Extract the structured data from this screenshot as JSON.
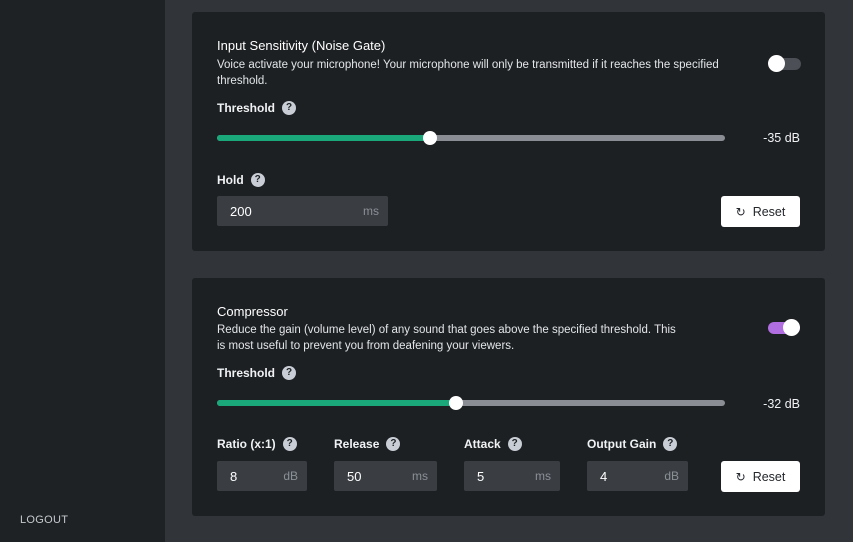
{
  "sidebar": {
    "logout_label": "LOGOUT"
  },
  "noise_gate": {
    "title": "Input Sensitivity (Noise Gate)",
    "description_line1": "Voice activate your microphone! Your microphone will only be transmitted if it reaches the specified",
    "description_line2": "threshold.",
    "enabled": false,
    "threshold_label": "Threshold",
    "threshold_value_text": "-35 dB",
    "threshold_fraction": 0.42,
    "hold_label": "Hold",
    "hold_value": "200",
    "hold_unit": "ms",
    "reset_label": "Reset"
  },
  "compressor": {
    "title": "Compressor",
    "description_line1": "Reduce the gain (volume level) of any sound that goes above the specified threshold. This",
    "description_line2": "is most useful to prevent you from deafening your viewers.",
    "enabled": true,
    "threshold_label": "Threshold",
    "threshold_value_text": "-32 dB",
    "threshold_fraction": 0.47,
    "ratio_label": "Ratio (x:1)",
    "ratio_value": "8",
    "ratio_unit": "dB",
    "release_label": "Release",
    "release_value": "50",
    "release_unit": "ms",
    "attack_label": "Attack",
    "attack_value": "5",
    "attack_unit": "ms",
    "output_gain_label": "Output Gain",
    "output_gain_value": "4",
    "output_gain_unit": "dB",
    "reset_label": "Reset"
  },
  "icons": {
    "help": "?",
    "reset": "↻"
  },
  "colors": {
    "slider_fill": "#1aa87a",
    "toggle_on": "#b06ee0",
    "toggle_off": "#4c5056"
  }
}
